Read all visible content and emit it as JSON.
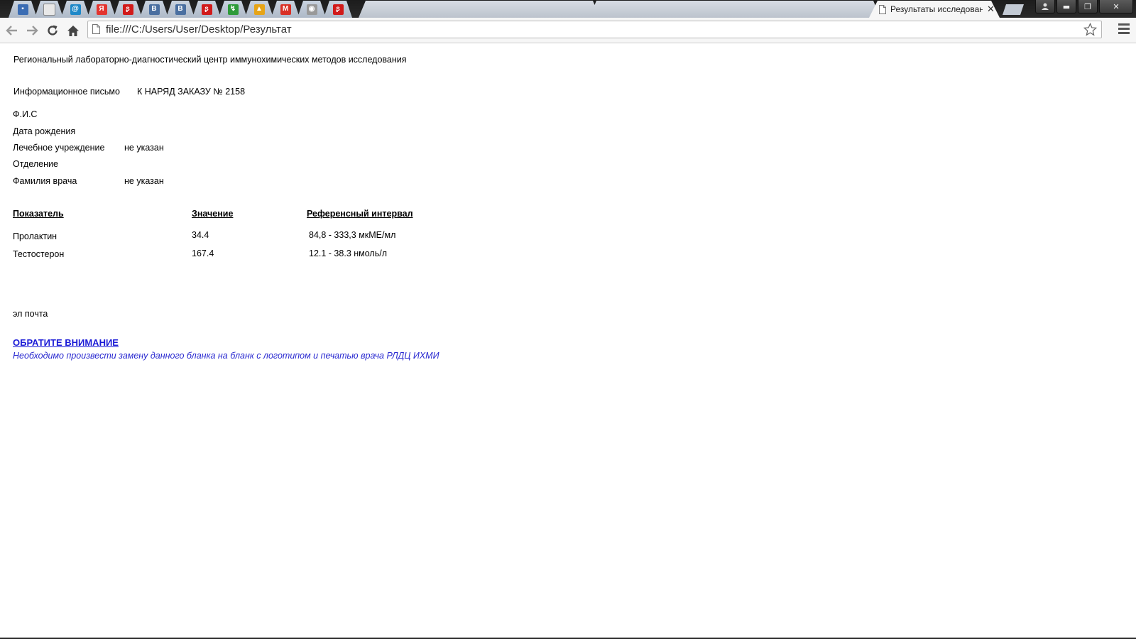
{
  "browser": {
    "active_tab": {
      "title": "Результаты исследован",
      "close": "✕"
    },
    "address": "file:///C:/Users/User/Desktop/Результат",
    "controls": {
      "minimize": "▬",
      "maximize": "❐",
      "close": "✕"
    },
    "pinned_tabs": [
      {
        "icon": "chat-icon",
        "glyph": "▪",
        "color": "#3b6db4"
      },
      {
        "icon": "page-icon",
        "glyph": "",
        "color": "#e8e8e8"
      },
      {
        "icon": "mail-ru-icon",
        "glyph": "@",
        "color": "#1e88c8"
      },
      {
        "icon": "yandex-icon",
        "glyph": "Я",
        "color": "#e3342f"
      },
      {
        "icon": "lastfm-icon",
        "glyph": "ʂ",
        "color": "#d11a1a"
      },
      {
        "icon": "vk-icon",
        "glyph": "B",
        "color": "#4a6fa0"
      },
      {
        "icon": "vk-icon",
        "glyph": "B",
        "color": "#4a6fa0"
      },
      {
        "icon": "lastfm-icon",
        "glyph": "ʂ",
        "color": "#d11a1a"
      },
      {
        "icon": "green-icon",
        "glyph": "↯",
        "color": "#2e9b3a"
      },
      {
        "icon": "warning-icon",
        "glyph": "▲",
        "color": "#e6a417"
      },
      {
        "icon": "gmail-icon",
        "glyph": "M",
        "color": "#d93025"
      },
      {
        "icon": "gray-icon",
        "glyph": "◉",
        "color": "#999999"
      },
      {
        "icon": "red-icon",
        "glyph": "ʂ",
        "color": "#d11a1a"
      }
    ]
  },
  "page": {
    "org_name": "Региональный лабораторно-диагностический центр иммунохимических методов исследования",
    "letter_label": "Информационное письмо",
    "order_label": "К НАРЯД ЗАКАЗУ № 2158",
    "patient": {
      "fio_label": "Ф.И.С",
      "birth_label": "Дата рождения",
      "clinic_label": "Лечебное учреждение",
      "clinic_value": "не указан",
      "department_label": "Отделение",
      "doctor_label": "Фамилия врача",
      "doctor_value": "не указан"
    },
    "results_table": {
      "headers": [
        "Показатель",
        "Значение",
        "Референсный интервал"
      ],
      "rows": [
        {
          "name": "Пролактин",
          "value": "34.4",
          "range": "84,8 - 333,3 мкМЕ/мл"
        },
        {
          "name": "Тестостерон",
          "value": "167.4",
          "range": "12.1 - 38.3 нмоль/л"
        }
      ]
    },
    "email_label": "эл почта",
    "notice_title": "ОБРАТИТЕ ВНИМАНИЕ",
    "notice_text": "Необходимо произвести замену данного бланка на бланк с логотипом и печатью врача РЛДЦ ИХМИ"
  }
}
